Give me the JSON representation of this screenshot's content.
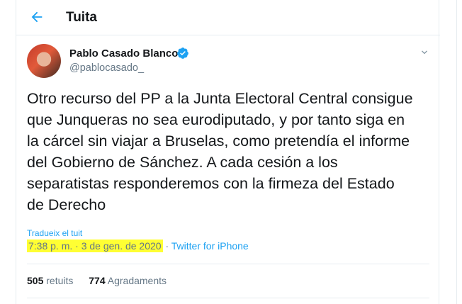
{
  "header": {
    "title": "Tuita",
    "back_icon": "arrow-left-icon"
  },
  "tweet": {
    "author_name": "Pablo Casado Blanco",
    "author_handle": "@pablocasado_",
    "text": "Otro recurso del PP a la Junta Electoral Central consigue\nque Junqueras no sea eurodiputado, y por tanto siga en\nla cárcel sin viajar a Bruselas, como pretendía el informe\ndel Gobierno de Sánchez. A cada cesión a los\nseparatistas responderemos con la firmeza del Estado\nde Derecho",
    "translate_label": "Tradueix el tuit",
    "timestamp": "7:38 p. m. · 3 de gen. de 2020",
    "separator": " · ",
    "source": "Twitter for iPhone"
  },
  "stats": {
    "retweets_count": "505",
    "retweets_label": "retuits",
    "likes_count": "774",
    "likes_label": "Agradaments"
  },
  "colors": {
    "accent": "#1da1f2",
    "highlight": "#ffff33",
    "muted": "#657786",
    "text": "#14171a"
  }
}
